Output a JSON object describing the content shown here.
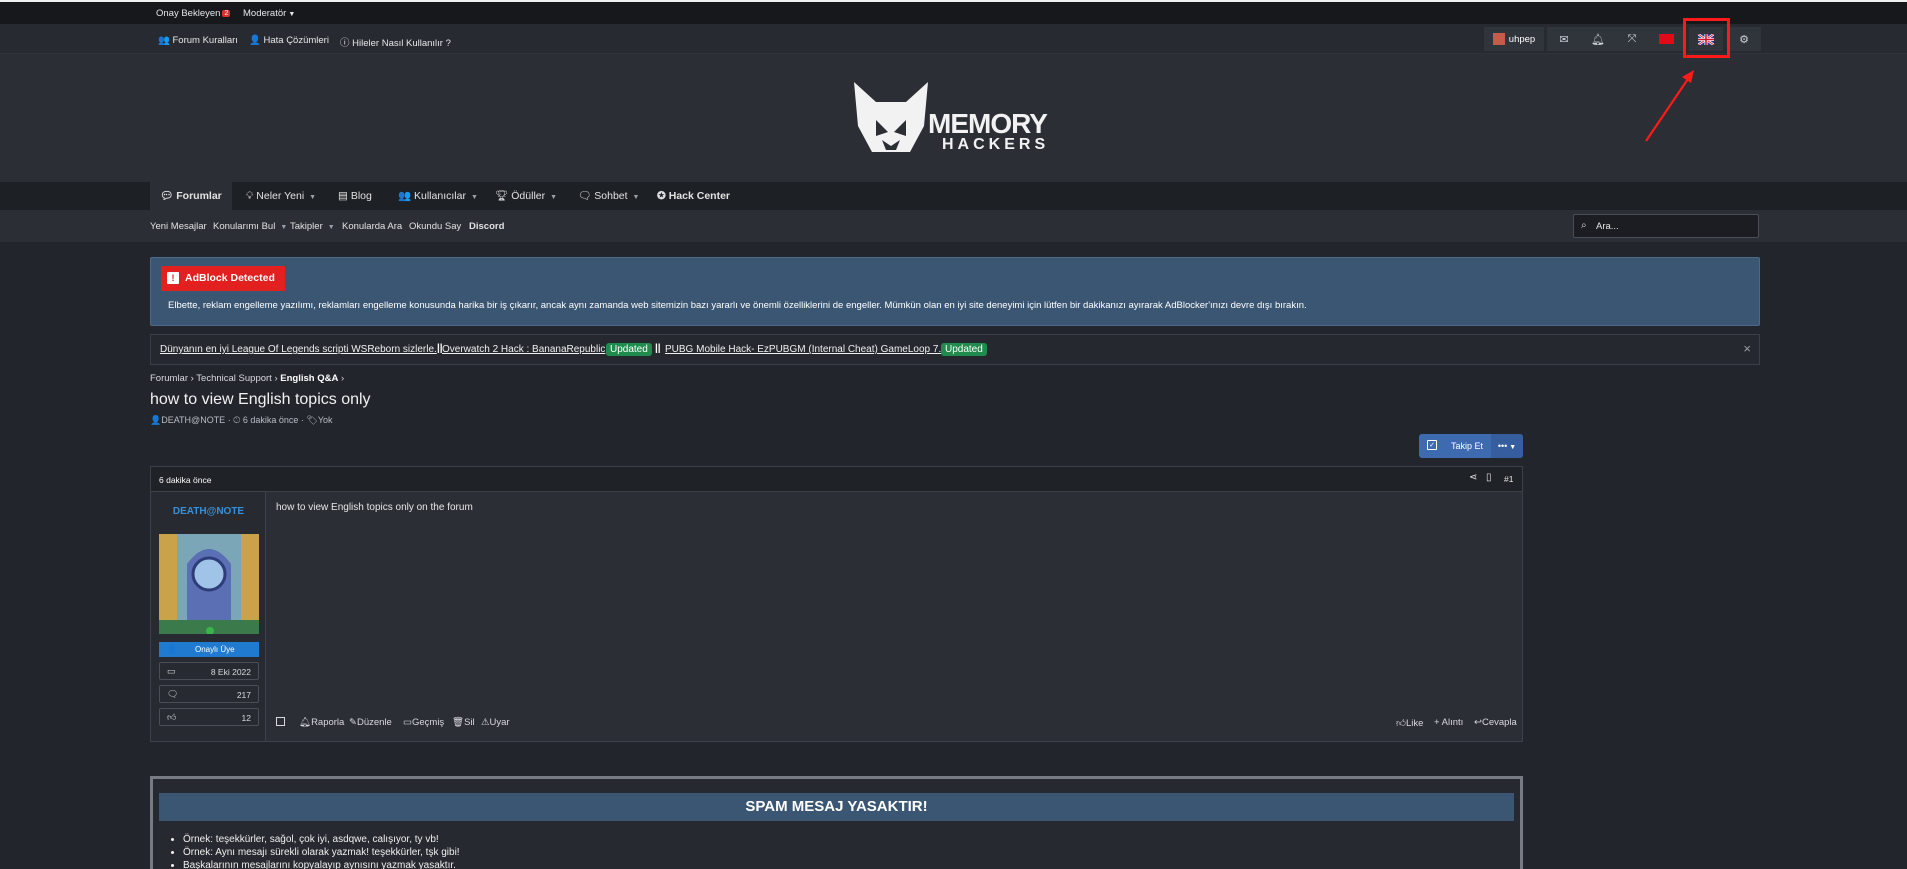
{
  "staffbar": {
    "approval": "Onay Bekleyen",
    "approval_count": "2",
    "moderator": "Moderatör"
  },
  "linkbar": {
    "rules": "Forum Kuralları",
    "bugs": "Hata Çözümleri",
    "howto": "Hileler Nasıl Kullanılır ?",
    "username": "uhpep"
  },
  "brand": {
    "line1": "MEMORY",
    "line2": "HACKERS"
  },
  "nav": {
    "tabs": [
      {
        "label": "Forumlar"
      },
      {
        "label": "Neler Yeni"
      },
      {
        "label": "Blog"
      },
      {
        "label": "Kullanıcılar"
      },
      {
        "label": "Ödüller"
      },
      {
        "label": "Sohbet"
      },
      {
        "label": "Hack Center"
      }
    ]
  },
  "subnav": {
    "items": [
      "Yeni Mesajlar",
      "Konularımı Bul",
      "Takipler",
      "Konularda Ara",
      "Okundu Say",
      "Discord"
    ],
    "search_placeholder": "Ara..."
  },
  "adblock": {
    "title": "AdBlock Detected",
    "text": "Elbette, reklam engelleme yazılımı, reklamları engelleme konusunda harika bir iş çıkarır, ancak aynı zamanda web sitemizin bazı yararlı ve önemli özelliklerini de engeller. Mümkün olan en iyi site deneyimi için lütfen bir dakikanızı ayırarak AdBlocker'ınızı devre dışı bırakın."
  },
  "ticker": {
    "link1": "Dünyanın en iyi League Of Legends scripti WSReborn sizlerle.",
    "link2": "Overwatch 2 Hack : BananaRepublic",
    "badge": "Updated",
    "link3": "PUBG Mobile Hack- EzPUBGM (Internal Cheat) GameLoop 7.1",
    "separator": "||"
  },
  "breadcrumb": {
    "c1": "Forumlar",
    "c2": "Technical Support",
    "c3": "English Q&A"
  },
  "thread": {
    "title": "how to view English topics only",
    "author": "DEATH@NOTE",
    "time": "6 dakika önce",
    "tags": "Yok",
    "follow_label": "Takip Et",
    "more_label": "•••"
  },
  "post": {
    "time": "6 dakika önce",
    "number": "#1",
    "username": "DEATH@NOTE",
    "role": "Onaylı Üye",
    "joined": "8 Eki 2022",
    "messages": "217",
    "reactions": "12",
    "body": "how to view English topics only on the forum",
    "actions": {
      "report": "Raporla",
      "edit": "Düzenle",
      "history": "Geçmiş",
      "delete": "Sil",
      "warn": "Uyar",
      "like": "Like",
      "quote": "+ Alıntı",
      "reply": "Cevapla"
    }
  },
  "notice": {
    "title": "SPAM MESAJ YASAKTIR!",
    "items": [
      "Örnek: teşekkürler, sağol, çok iyi, asdqwe, calışıyor, ty vb!",
      "Örnek: Aynı mesajı sürekli olarak yazmak! teşekkürler, tşk gibi!",
      "Başkalarının mesajlarını kopyalayıp aynısını yazmak yasaktır."
    ]
  },
  "colors": {
    "accent": "#3e6ab0",
    "alert": "#e32020",
    "highlight": "#ff1a1a",
    "updated": "#1f8b4c"
  }
}
